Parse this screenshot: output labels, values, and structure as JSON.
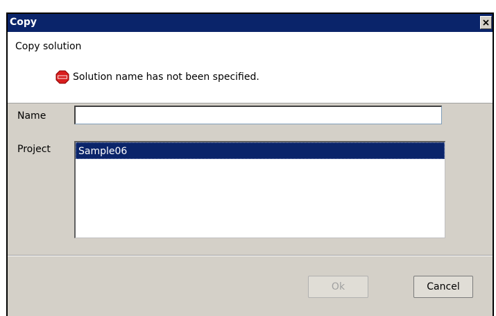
{
  "window": {
    "title": "Copy",
    "close_icon": "close-icon"
  },
  "header": {
    "title": "Copy solution",
    "error_icon": "stop-icon",
    "error_message": "Solution name has not been specified."
  },
  "form": {
    "name_label": "Name",
    "name_value": "",
    "project_label": "Project",
    "project_items": [
      "Sample06"
    ],
    "selected_project": "Sample06"
  },
  "buttons": {
    "ok_label": "Ok",
    "ok_enabled": false,
    "cancel_label": "Cancel"
  },
  "colors": {
    "titlebar": "#0a246a",
    "selection": "#0a246a",
    "dialog_bg": "#d4d0c8",
    "stop_red": "#d81e1e"
  }
}
